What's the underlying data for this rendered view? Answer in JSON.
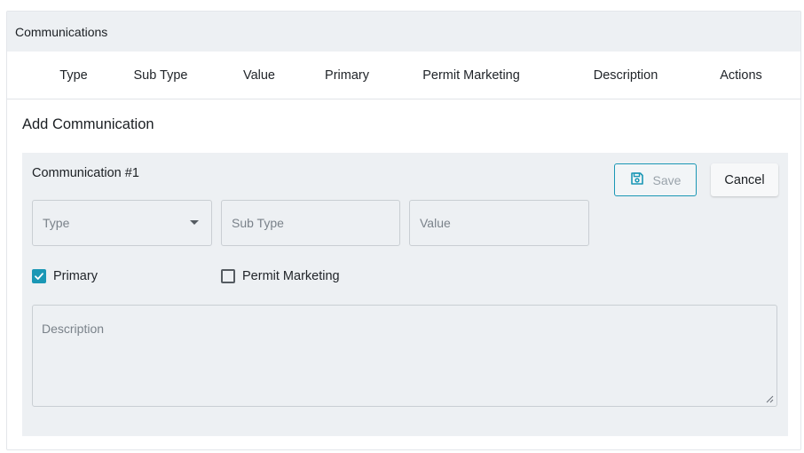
{
  "panel": {
    "title": "Communications"
  },
  "table": {
    "columns": [
      "Type",
      "Sub Type",
      "Value",
      "Primary",
      "Permit Marketing",
      "Description",
      "Actions"
    ]
  },
  "add_section": {
    "title": "Add Communication"
  },
  "form": {
    "title": "Communication #1",
    "save_label": "Save",
    "cancel_label": "Cancel",
    "type_placeholder": "Type",
    "subtype_placeholder": "Sub Type",
    "value_placeholder": "Value",
    "primary_label": "Primary",
    "primary_checked": true,
    "permit_marketing_label": "Permit Marketing",
    "permit_marketing_checked": false,
    "description_placeholder": "Description"
  },
  "colors": {
    "accent": "#1a97b5",
    "surface": "#edf0f3"
  },
  "icons": {
    "save": "floppy-disk-icon",
    "dropdown": "caret-down-icon",
    "check": "check-icon"
  }
}
